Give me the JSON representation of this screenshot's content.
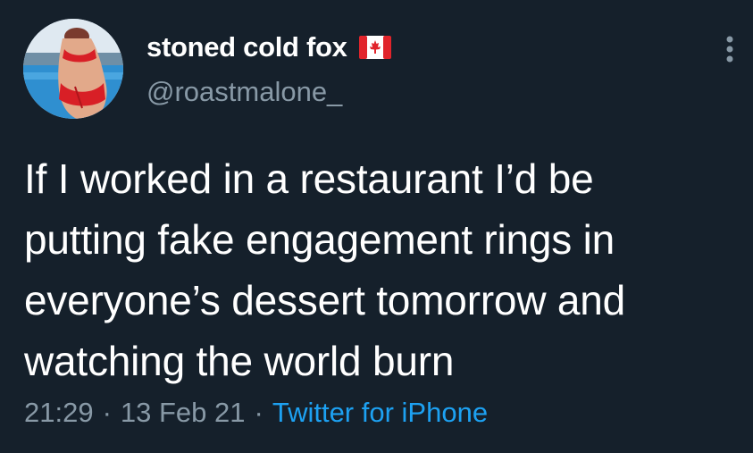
{
  "user": {
    "display_name": "stoned cold fox",
    "handle": "@roastmalone_",
    "flag_icon": "canada-flag-icon"
  },
  "tweet": {
    "text": "If I worked in a restaurant I’d be\nputting fake engagement rings in\neveryone’s dessert tomorrow and\nwatching the world burn",
    "time": "21:29",
    "date": "13 Feb 21",
    "separator": "·",
    "source": "Twitter for iPhone"
  },
  "colors": {
    "background": "#15202b",
    "primary_text": "#ffffff",
    "secondary_text": "#8899a6",
    "link": "#1da1f2"
  },
  "icons": {
    "more": "more-vertical-icon",
    "avatar": "avatar"
  }
}
